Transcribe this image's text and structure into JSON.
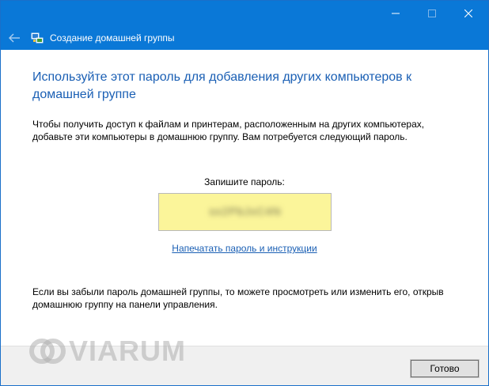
{
  "window": {
    "nav_title": "Создание домашней группы"
  },
  "content": {
    "heading": "Используйте этот пароль для добавления других компьютеров к домашней группе",
    "description": "Чтобы получить доступ к файлам и принтерам, расположенным на других компьютерах, добавьте эти компьютеры в домашнюю группу. Вам потребуется следующий пароль.",
    "password_label": "Запишите пароль:",
    "password_value": "sx2PbJxC4N",
    "print_link": "Напечатать пароль и инструкции",
    "hint": "Если вы забыли пароль домашней группы, то можете просмотреть или изменить его, открыв домашнюю группу на панели управления."
  },
  "footer": {
    "done_label": "Готово"
  },
  "watermark": {
    "text": "VIARUM"
  },
  "colors": {
    "titlebar": "#0a78d7",
    "heading": "#1a5fb4",
    "password_bg": "#fbf59a",
    "footer_bg": "#f0f0f0"
  }
}
